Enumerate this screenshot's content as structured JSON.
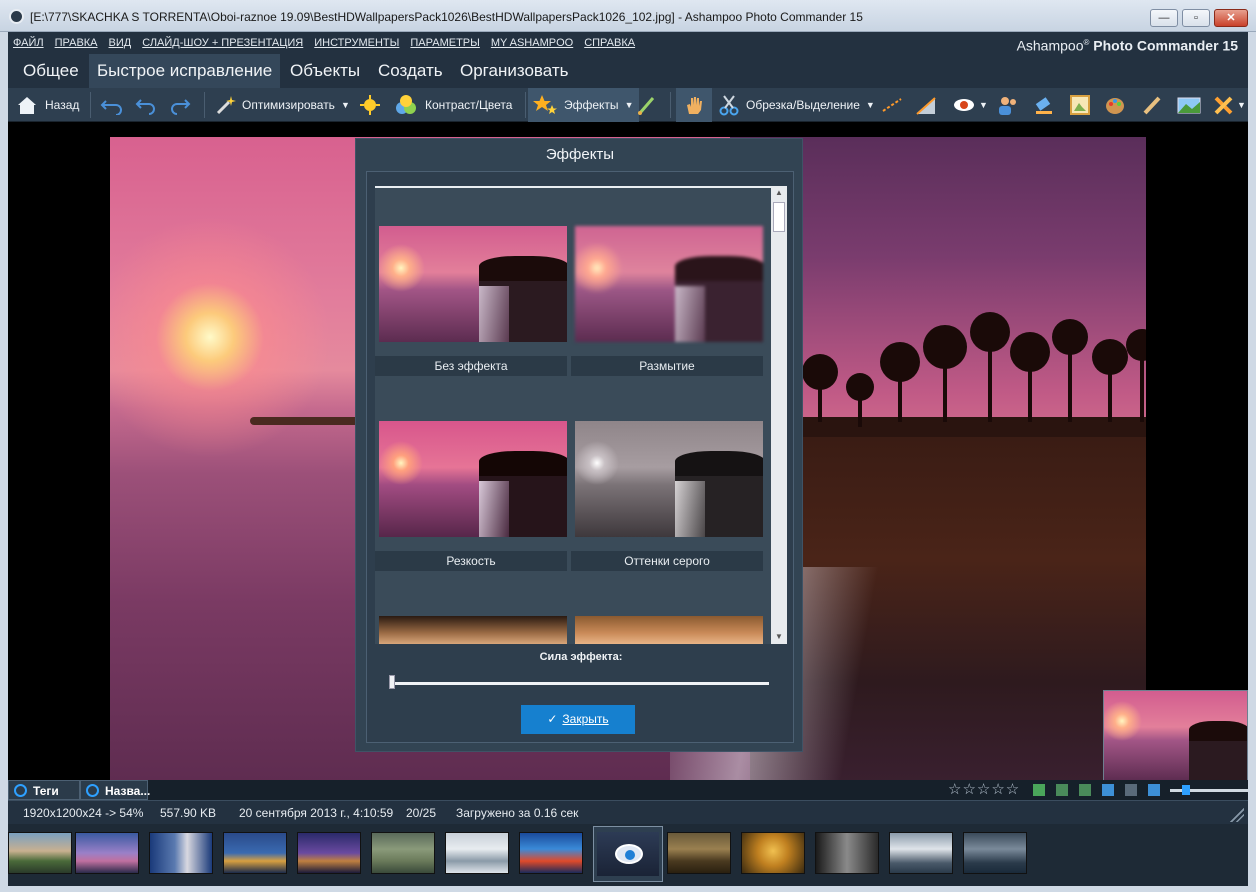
{
  "window": {
    "title": "[E:\\777\\SKACHKA S TORRENTA\\Oboi-raznoe 19.09\\BestHDWallpapersPack1026\\BestHDWallpapersPack1026_102.jpg] - Ashampoo Photo Commander 15",
    "minimize": "—",
    "maximize": "▫",
    "close": "✕"
  },
  "menu": [
    "ФАЙЛ",
    "ПРАВКА",
    "ВИД",
    "СЛАЙД-ШОУ + ПРЕЗЕНТАЦИЯ",
    "ИНСТРУМЕНТЫ",
    "ПАРАМЕТРЫ",
    "MY ASHAMPOO",
    "СПРАВКА"
  ],
  "brand": {
    "prefix": "Ashampoo",
    "registered": "®",
    "product": " Photo Commander 15"
  },
  "tabs": [
    "Общее",
    "Быстрое исправление",
    "Объекты",
    "Создать",
    "Организовать"
  ],
  "toolbar": {
    "back": "Назад",
    "optimize": "Оптимизировать",
    "contrast": "Контраст/Цвета",
    "effects": "Эффекты",
    "crop": "Обрезка/Выделение"
  },
  "dialog": {
    "title": "Эффекты",
    "effects": [
      "Без эффекта",
      "Размытие",
      "Резкость",
      "Оттенки серого"
    ],
    "strength_label": "Сила эффекта:",
    "strength": 0,
    "close": "Закрыть"
  },
  "tagbar": {
    "tags": "Теги",
    "names": "Назва...",
    "stars": "☆☆☆☆☆",
    "rating": 0
  },
  "status": {
    "dims": "1920x1200x24 -> 54%",
    "size": "557.90 KB",
    "date": "20 сентября 2013 г., 4:10:59",
    "index": "20/25",
    "loaded": "Загружено за 0.16 сек"
  },
  "colors": {
    "accent": "#1680cf",
    "panel": "#324453",
    "background": "#233140"
  }
}
